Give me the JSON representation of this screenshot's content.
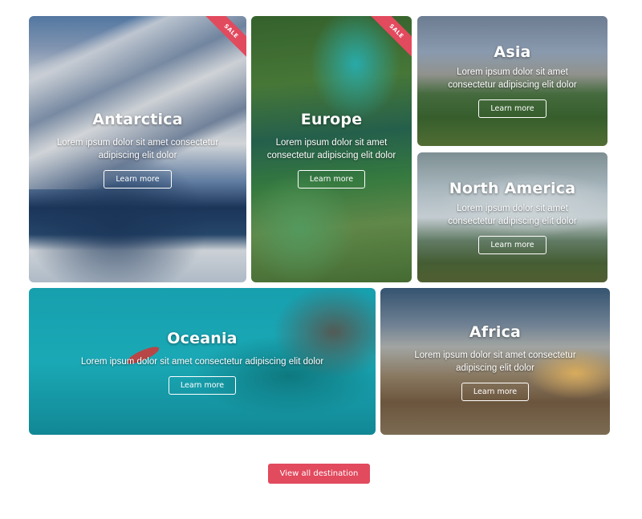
{
  "ribbon_label": "SALE",
  "cards": {
    "antarctica": {
      "title": "Antarctica",
      "line1": "Lorem ipsum dolor sit amet consectetur",
      "line2": "adipiscing elit dolor",
      "button": "Learn more",
      "sale": true
    },
    "europe": {
      "title": "Europe",
      "line1": "Lorem ipsum dolor sit amet",
      "line2": "consectetur adipiscing elit dolor",
      "button": "Learn more",
      "sale": true
    },
    "asia": {
      "title": "Asia",
      "line1": "Lorem ipsum dolor sit amet",
      "line2": "consectetur adipiscing elit dolor",
      "button": "Learn more",
      "sale": false
    },
    "north_america": {
      "title": "North America",
      "line1": "Lorem ipsum dolor sit amet",
      "line2": "consectetur adipiscing elit dolor",
      "button": "Learn more",
      "sale": false
    },
    "oceania": {
      "title": "Oceania",
      "line1": "Lorem ipsum dolor sit amet consectetur adipiscing elit dolor",
      "button": "Learn more",
      "sale": false
    },
    "africa": {
      "title": "Africa",
      "line1": "Lorem ipsum dolor sit amet consectetur",
      "line2": "adipiscing elit dolor",
      "button": "Learn more",
      "sale": false
    }
  },
  "footer": {
    "view_all_label": "View all destination"
  },
  "colors": {
    "accent": "#e24a5e",
    "text_on_image": "#ffffff",
    "background": "#ffffff"
  }
}
